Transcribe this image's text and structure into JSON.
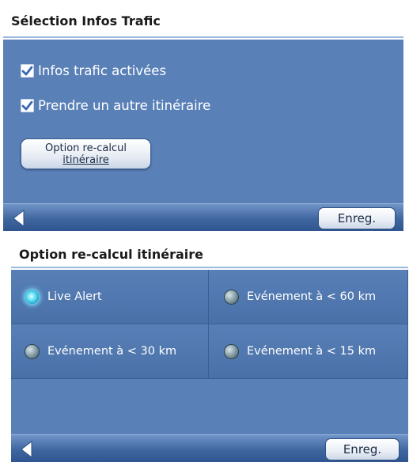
{
  "traffic_screen": {
    "title": "Sélection Infos Trafic",
    "checkboxes": [
      {
        "label": "Infos trafic activées",
        "checked": true
      },
      {
        "label": "Prendre un autre itinéraire",
        "checked": true
      }
    ],
    "recalc_button": {
      "line1": "Option re-calcul",
      "line2": "itinéraire"
    },
    "save_label": "Enreg."
  },
  "recalc_screen": {
    "title": "Option re-calcul itinéraire",
    "options": [
      {
        "label": "Live Alert",
        "selected": true
      },
      {
        "label": "Evénement à < 60 km",
        "selected": false
      },
      {
        "label": "Evénement à < 30 km",
        "selected": false
      },
      {
        "label": "Evénement à < 15 km",
        "selected": false
      }
    ],
    "save_label": "Enreg."
  },
  "icons": {
    "back": "back-arrow-icon",
    "checkbox": "checkmark-icon",
    "radio": "radio-button-icon"
  },
  "colors": {
    "panel_blue": "#5a80b8",
    "bar_blue": "#3f659e",
    "radio_selected": "#4fd8f0"
  }
}
